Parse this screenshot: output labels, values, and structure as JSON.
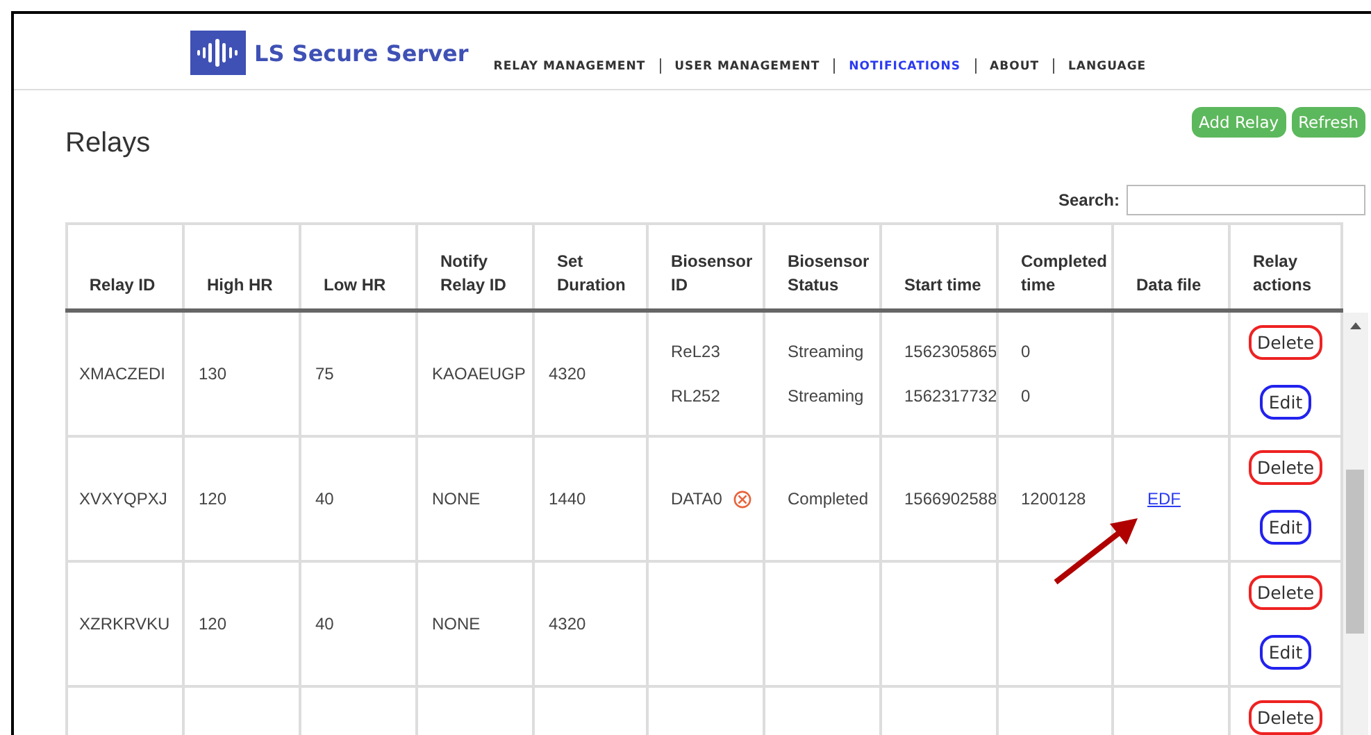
{
  "header": {
    "logo_text": "LS Secure Server",
    "nav": [
      {
        "label": "RELAY MANAGEMENT",
        "selected": false
      },
      {
        "label": "USER MANAGEMENT",
        "selected": false
      },
      {
        "label": "NOTIFICATIONS",
        "selected": true
      },
      {
        "label": "ABOUT",
        "selected": false
      },
      {
        "label": "LANGUAGE",
        "selected": false
      }
    ]
  },
  "toolbar": {
    "buttons": [
      "Add Relay",
      "Refresh"
    ]
  },
  "page_title": "Relays",
  "search": {
    "label": "Search:"
  },
  "table": {
    "columns": [
      "Relay ID",
      "High HR",
      "Low HR",
      "Notify Relay ID",
      "Set Duration",
      "Biosensor ID",
      "Biosensor Status",
      "Start time",
      "Completed time",
      "Data file",
      "Relay actions"
    ],
    "rows": [
      {
        "relay_id": "XMACZEDI",
        "high_hr": "130",
        "low_hr": "75",
        "notify_relay_id": "KAOAEUGP",
        "set_duration": "4320",
        "biosensors": [
          {
            "id": "ReL23",
            "status": "Streaming",
            "start_time": "1562305865",
            "completed_time": "0",
            "error": false
          },
          {
            "id": "RL252",
            "status": "Streaming",
            "start_time": "1562317732",
            "completed_time": "0",
            "error": false
          }
        ],
        "actions": [
          {
            "kind": "delete",
            "label": "Delete"
          },
          {
            "kind": "edit",
            "label": "Edit"
          }
        ]
      },
      {
        "relay_id": "XVXYQPXJ",
        "high_hr": "120",
        "low_hr": "40",
        "notify_relay_id": "NONE",
        "set_duration": "1440",
        "biosensors": [
          {
            "id": "DATA0",
            "status": "Completed",
            "start_time": "1566902588",
            "completed_time": "1200128",
            "error": true
          }
        ],
        "data_file": "EDF",
        "actions": [
          {
            "kind": "delete",
            "label": "Delete"
          },
          {
            "kind": "edit",
            "label": "Edit"
          }
        ]
      },
      {
        "relay_id": "XZRKRVKU",
        "high_hr": "120",
        "low_hr": "40",
        "notify_relay_id": "NONE",
        "set_duration": "4320",
        "biosensors": [],
        "actions": [
          {
            "kind": "delete",
            "label": "Delete"
          },
          {
            "kind": "edit",
            "label": "Edit"
          }
        ]
      },
      {
        "relay_id": "",
        "high_hr": "",
        "low_hr": "",
        "notify_relay_id": "",
        "set_duration": "",
        "biosensors": [],
        "actions": [
          {
            "kind": "delete",
            "label": "Delete"
          }
        ]
      }
    ]
  }
}
